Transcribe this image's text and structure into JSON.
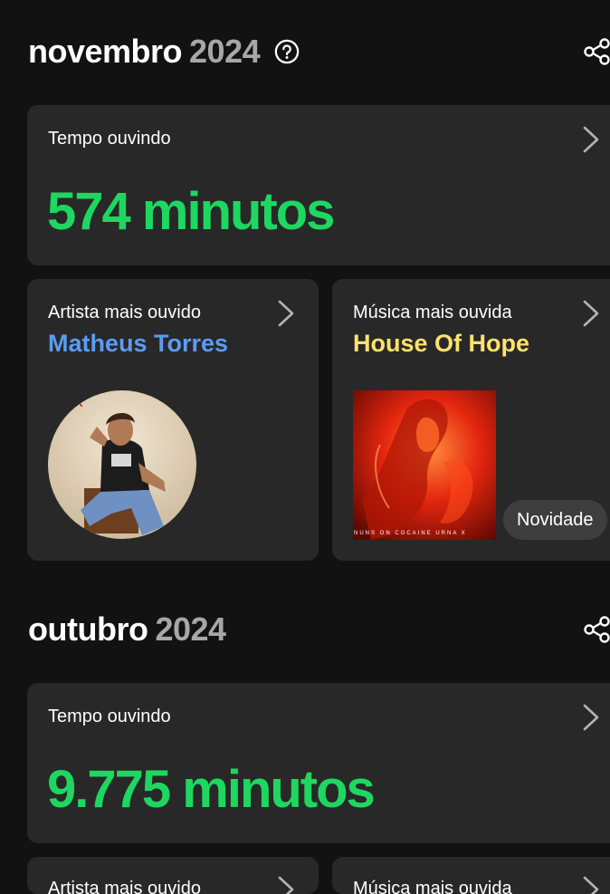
{
  "months": [
    {
      "name": "novembro",
      "year": "2024",
      "listening_label": "Tempo ouvindo",
      "listening_value": "574 minutos",
      "top_artist_label": "Artista mais ouvido",
      "top_artist_name": "Matheus Torres",
      "top_song_label": "Música mais ouvida",
      "top_song_name": "House Of Hope",
      "album_caption": "NUNS ON COCAINE  URNA X",
      "badge": "Novidade"
    },
    {
      "name": "outubro",
      "year": "2024",
      "listening_label": "Tempo ouvindo",
      "listening_value": "9.775 minutos",
      "top_artist_label": "Artista mais ouvido",
      "top_song_label": "Música mais ouvida"
    }
  ],
  "colors": {
    "background": "#121212",
    "card": "#282828",
    "accent_green": "#1ed760",
    "artist_blue": "#5b9cf4",
    "song_yellow": "#ffe16e",
    "year_gray": "#a7a7a7"
  },
  "icons": {
    "help": "help-circle-icon",
    "share": "share-icon",
    "chevron": "chevron-right-icon"
  }
}
